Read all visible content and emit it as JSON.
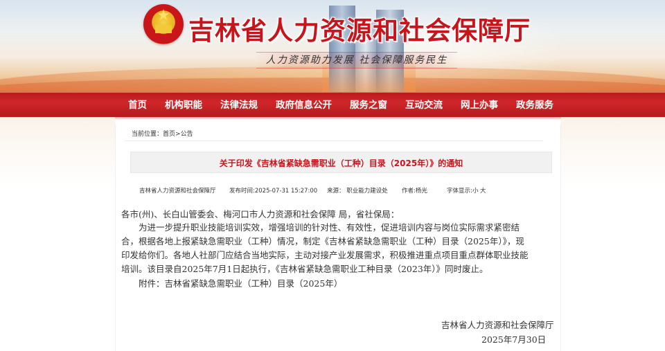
{
  "header": {
    "site_title": "吉林省人力资源和社会保障厅",
    "slogan": "人力资源助力发展   社会保障服务民生"
  },
  "nav": {
    "items": [
      "首页",
      "机构职能",
      "法律法规",
      "政府信息公开",
      "服务之窗",
      "互动交流",
      "网上办事",
      "政务服务"
    ]
  },
  "breadcrumb": {
    "prefix": "当前位置：",
    "home": "首页",
    "sep": ">",
    "current": "公告"
  },
  "article": {
    "title": "关于印发《吉林省紧缺急需职业（工种）目录（2025年）》的通知",
    "meta": {
      "publisher": "吉林省人力资源和社会保障厅",
      "publish_time": "发布时间:2025-07-31 15:27:00",
      "source": "来源：  职业能力建设处",
      "author": "作者:杨光",
      "font_size_label": "字体显示:",
      "font_small": "小",
      "font_large": "大"
    },
    "lines": [
      "各市(州)、长白山管委会、梅河口市人力资源和社会保障 局，省社保局：",
      "　　为进一步提升职业技能培训实效，增强培训的针对性、有效性，促进培训内容与岗位实际需求紧密结",
      "合，根据各地上报紧缺急需职业（工种）情况，制定《吉林省紧缺急需职业（工种）目录（2025年）》，现",
      "印发给你们。各地人社部门应结合当地实际，主动对接产业发展需求，积极推进重点项目重点群体职业技能",
      "培训。该目录自2025年7月1日起执行，《吉林省紧缺急需职业工种目录（2023年）》同时废止。",
      "　　附件：吉林省紧缺急需职业（工种）目录（2025年）"
    ],
    "signature": "吉林省人力资源和社会保障厅",
    "date": "2025年7月30日"
  },
  "colors": {
    "brand_red": "#c8141b",
    "nav_red": "#c21f23",
    "title_bg": "#f1f1f1"
  }
}
